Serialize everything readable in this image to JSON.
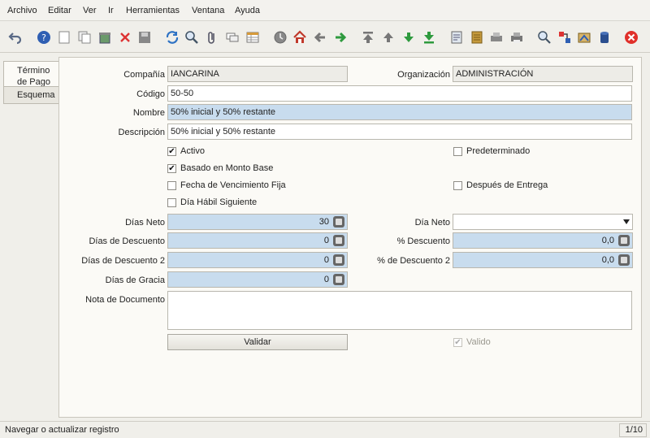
{
  "menu": [
    "Archivo",
    "Editar",
    "Ver",
    "Ir",
    "Herramientas",
    "Ventana",
    "Ayuda"
  ],
  "tabs": {
    "active_line1": "Término",
    "active_line2": "de Pago",
    "schema": "Esquema"
  },
  "form": {
    "company_label": "Compañía",
    "company_value": "IANCARINA",
    "org_label": "Organización",
    "org_value": "ADMINISTRACIÓN",
    "code_label": "Código",
    "code_value": "50-50",
    "name_label": "Nombre",
    "name_value": "50% inicial y 50% restante",
    "desc_label": "Descripción",
    "desc_value": "50% inicial y 50% restante",
    "active_label": "Activo",
    "default_label": "Predeterminado",
    "based_amount_label": "Basado en Monto Base",
    "fixed_due_label": "Fecha de Vencimiento Fija",
    "after_delivery_label": "Después de Entrega",
    "next_business_label": "Día Hábil Siguiente",
    "net_days_label": "Días Neto",
    "net_days_value": "30",
    "net_day_label": "Día Neto",
    "net_day_value": "",
    "discount_days_label": "Días de Descuento",
    "discount_days_value": "0",
    "discount_pct_label": "% Descuento",
    "discount_pct_value": "0,0",
    "discount_days2_label": "Días de Descuento 2",
    "discount_days2_value": "0",
    "discount_pct2_label": "% de Descuento 2",
    "discount_pct2_value": "0,0",
    "grace_days_label": "Días de Gracia",
    "grace_days_value": "0",
    "doc_note_label": "Nota de Documento",
    "doc_note_value": "",
    "validate_button": "Validar",
    "valid_label": "Valido"
  },
  "status": {
    "message": "Navegar o actualizar registro",
    "record": "1/10"
  },
  "colors": {
    "editable_blue": "#c8dcee",
    "readonly": "#edece7",
    "panel": "#fbfaf6"
  }
}
